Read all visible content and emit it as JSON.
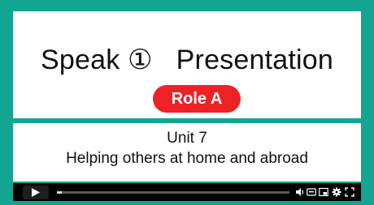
{
  "slide": {
    "title": "Speak ①   Presentation",
    "role_badge": "Role A",
    "unit_title": "Unit 7",
    "unit_subtitle": "Helping others at home and abroad"
  },
  "player": {
    "progress_fraction": 0.02,
    "controls": [
      "play-icon",
      "volume-icon",
      "captions-icon",
      "picture-in-picture-icon",
      "settings-icon",
      "fullscreen-icon"
    ]
  },
  "colors": {
    "frame": "#12a591",
    "badge": "#ec2226",
    "player_bg": "#000000"
  }
}
